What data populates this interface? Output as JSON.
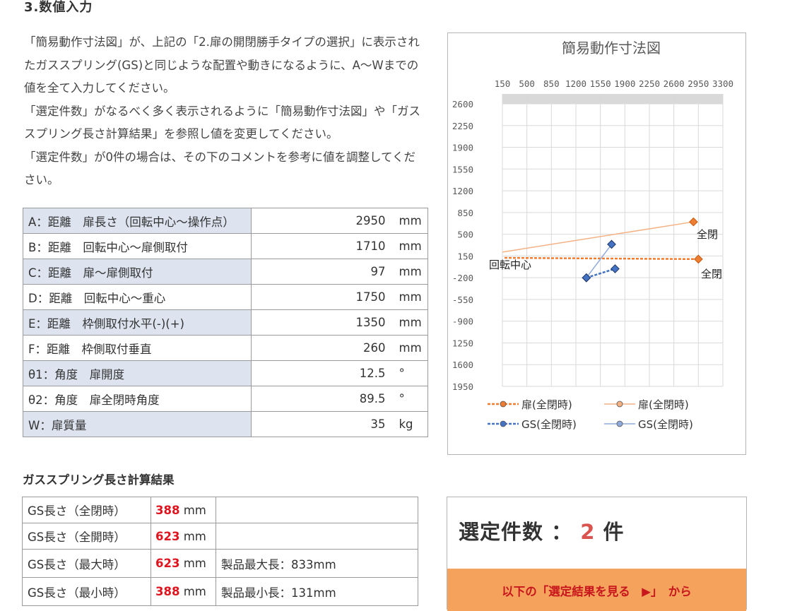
{
  "section": {
    "title": "3.数値入力"
  },
  "intro": {
    "line1": "「簡易動作寸法図」が、上記の「2.扉の開閉勝手タイプの選択」に表示されたガススプリング(GS)と同じような配置や動きになるように、A～Wまでの値を全て入力してください。",
    "line2": "「選定件数」がなるべく多く表示されるように「簡易動作寸法図」や「ガススプリング長さ計算結果」を参照し値を変更してください。",
    "line3": "「選定件数」が0件の場合は、その下のコメントを参考に値を調整してください。"
  },
  "params": [
    {
      "label": "A：距離　扉長さ（回転中心～操作点）",
      "value": "2950",
      "unit": "mm"
    },
    {
      "label": "B：距離　回転中心～扉側取付",
      "value": "1710",
      "unit": "mm"
    },
    {
      "label": "C：距離　扉～扉側取付",
      "value": "97",
      "unit": "mm"
    },
    {
      "label": "D：距離　回転中心～重心",
      "value": "1750",
      "unit": "mm"
    },
    {
      "label": "E：距離　枠側取付水平(-)(+)",
      "value": "1350",
      "unit": "mm"
    },
    {
      "label": "F：距離　枠側取付垂直",
      "value": "260",
      "unit": "mm"
    },
    {
      "label": "θ1：角度　扉開度",
      "value": "12.5",
      "unit": "°"
    },
    {
      "label": "θ2：角度　扉全閉時角度",
      "value": "89.5",
      "unit": "°"
    },
    {
      "label": "W：扉質量",
      "value": "35",
      "unit": "kg"
    }
  ],
  "chart_data": {
    "type": "line",
    "title": "簡易動作寸法図",
    "x_ticks": [
      "150",
      "500",
      "850",
      "1200",
      "1550",
      "1900",
      "2250",
      "2600",
      "2950",
      "3300"
    ],
    "y_ticks": [
      "2600",
      "2250",
      "1900",
      "1550",
      "1200",
      "850",
      "500",
      "150",
      "-200",
      "-550",
      "-900",
      "1250",
      "1600",
      "1950"
    ],
    "xlim": [
      150,
      3300
    ],
    "ylim": [
      -1950,
      2600
    ],
    "grid": true,
    "legend_position": "bottom",
    "annotations": [
      "回転中心",
      "全閉",
      "全閉"
    ],
    "series": [
      {
        "name": "扉(全閉時)",
        "style": "dashed",
        "color": "#ed7d31",
        "points": [
          [
            180,
            50
          ],
          [
            2950,
            30
          ]
        ]
      },
      {
        "name": "扉(全閉時)",
        "style": "solid",
        "color": "#f4b183",
        "points": [
          [
            150,
            140
          ],
          [
            2880,
            610
          ]
        ]
      },
      {
        "name": "GS(全閉時)",
        "style": "dashed",
        "color": "#4472c4",
        "points": [
          [
            1350,
            -260
          ],
          [
            1760,
            -120
          ]
        ]
      },
      {
        "name": "GS(全閉時)",
        "style": "solid",
        "color": "#8faadc",
        "points": [
          [
            1350,
            -260
          ],
          [
            1710,
            260
          ]
        ]
      }
    ]
  },
  "calc": {
    "title": "ガススプリング長さ計算結果",
    "rows": [
      {
        "label": "GS長さ（全閉時）",
        "value": "388",
        "unit": "mm",
        "note": ""
      },
      {
        "label": "GS長さ（全開時）",
        "value": "623",
        "unit": "mm",
        "note": ""
      },
      {
        "label": "GS長さ（最大時）",
        "value": "623",
        "unit": "mm",
        "note": "製品最大長：833mm"
      },
      {
        "label": "GS長さ（最小時）",
        "value": "388",
        "unit": "mm",
        "note": "製品最小長：131mm"
      }
    ]
  },
  "selection": {
    "label": "選定件数",
    "colon": "：",
    "count": "2",
    "suffix": "件",
    "banner": "以下の「選定結果を見る　▶」　から"
  }
}
